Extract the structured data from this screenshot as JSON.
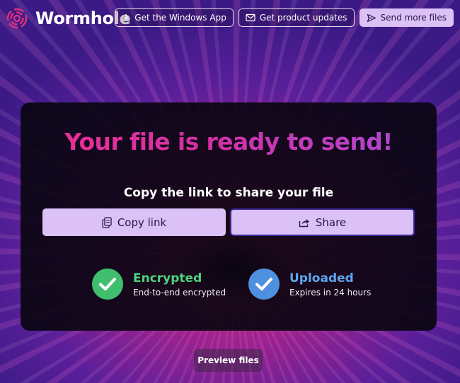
{
  "brand": {
    "name": "Wormhole",
    "logo_icon": "wormhole-swirl-icon"
  },
  "nav": {
    "windows_app": {
      "label": "Get the Windows App",
      "icon": "download-icon"
    },
    "updates": {
      "label": "Get product updates",
      "icon": "mail-icon"
    },
    "send_more": {
      "label": "Send more files",
      "icon": "send-icon"
    }
  },
  "card": {
    "headline": "Your file is ready to send!",
    "subhead": "Copy the link to share your file",
    "copy_link": {
      "label": "Copy link",
      "icon": "clipboard-icon"
    },
    "share": {
      "label": "Share",
      "icon": "share-icon"
    },
    "statuses": [
      {
        "title": "Encrypted",
        "subtitle": "End-to-end encrypted",
        "color": "#3fbf6e",
        "icon": "check-icon"
      },
      {
        "title": "Uploaded",
        "subtitle": "Expires in 24 hours",
        "color": "#4f8fe0",
        "icon": "check-icon"
      }
    ]
  },
  "preview": {
    "label": "Preview files"
  },
  "colors": {
    "accent": "#dcc1f7",
    "headline_start": "#ef2d8e",
    "headline_end": "#a84bd6"
  }
}
